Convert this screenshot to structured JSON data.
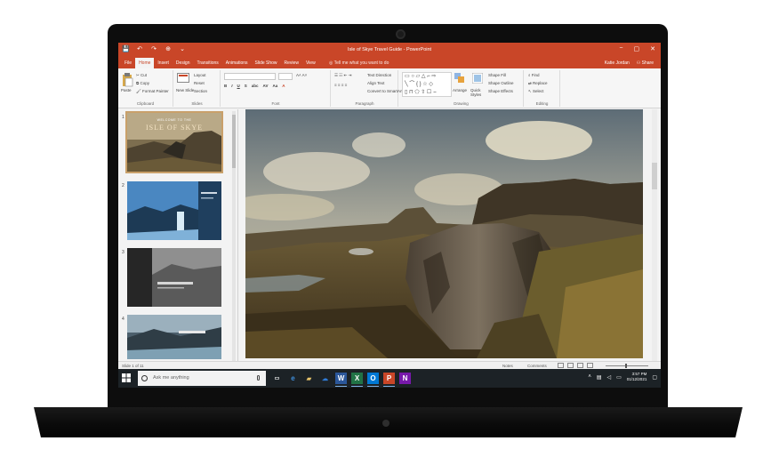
{
  "window": {
    "title": "Isle of Skye Travel Guide - PowerPoint",
    "controls": [
      "−",
      "▢",
      "✕"
    ],
    "qat": [
      "💾",
      "↶",
      "↷",
      "⊕",
      "⌄"
    ]
  },
  "tabs": [
    {
      "label": "File"
    },
    {
      "label": "Home",
      "active": true
    },
    {
      "label": "Insert"
    },
    {
      "label": "Design"
    },
    {
      "label": "Transitions"
    },
    {
      "label": "Animations"
    },
    {
      "label": "Slide Show"
    },
    {
      "label": "Review"
    },
    {
      "label": "View"
    }
  ],
  "tell_me": "Tell me what you want to do",
  "user": {
    "name": "Katie Jordan",
    "share": "Share"
  },
  "ribbon": {
    "clipboard": {
      "label": "Clipboard",
      "paste": "Paste",
      "cut": "Cut",
      "copy": "Copy",
      "format_painter": "Format Painter"
    },
    "slides": {
      "label": "Slides",
      "new_slide": "New Slide",
      "layout": "Layout",
      "reset": "Reset",
      "section": "Section"
    },
    "font": {
      "label": "Font",
      "styles": [
        "B",
        "I",
        "U",
        "S",
        "abc",
        "AV",
        "Aa",
        "A"
      ]
    },
    "paragraph": {
      "label": "Paragraph",
      "text_direction": "Text Direction",
      "align_text": "Align Text",
      "convert_smartart": "Convert to SmartArt"
    },
    "drawing": {
      "label": "Drawing",
      "arrange": "Arrange",
      "quick_styles": "Quick Styles",
      "shape_fill": "Shape Fill",
      "shape_outline": "Shape Outline",
      "shape_effects": "Shape Effects"
    },
    "editing": {
      "label": "Editing",
      "find": "Find",
      "replace": "Replace",
      "select": "Select"
    }
  },
  "thumbnails": [
    {
      "num": "1",
      "title": "ISLE OF SKYE",
      "subtitle": "WELCOME TO THE",
      "selected": true
    },
    {
      "num": "2"
    },
    {
      "num": "3"
    },
    {
      "num": "4"
    }
  ],
  "status": {
    "slide_count": "Slide 1 of 11",
    "notes": "Notes",
    "comments": "Comments"
  },
  "taskbar": {
    "search_placeholder": "Ask me anything",
    "clock_time": "3:57 PM",
    "clock_date": "01/12/2021"
  },
  "colors": {
    "accent": "#c94628",
    "taskbar": "#1c2226"
  }
}
